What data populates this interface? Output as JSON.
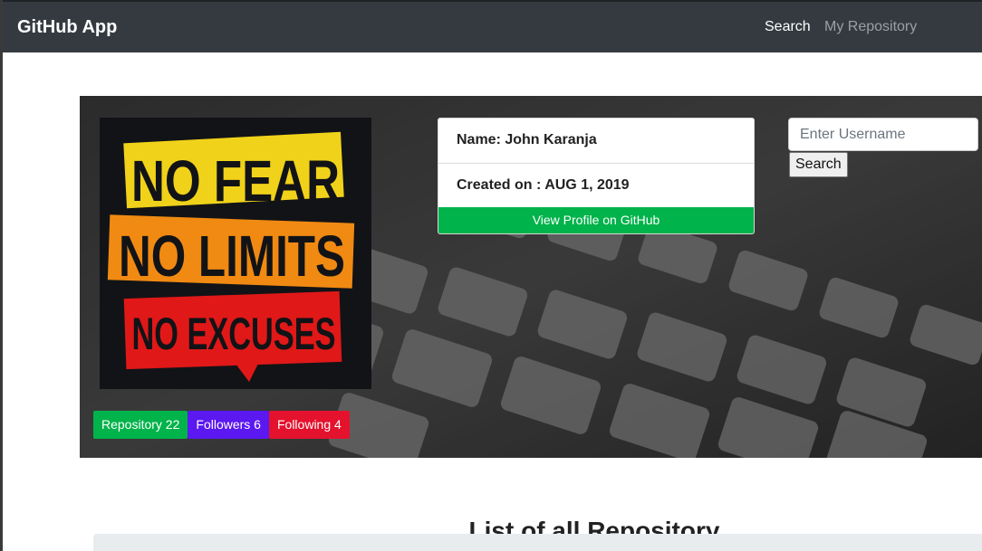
{
  "navbar": {
    "brand": "GitHub App",
    "links": [
      "Search",
      "My Repository"
    ]
  },
  "profile": {
    "avatar_alt": "profile avatar",
    "avatar_lines": [
      "NO FEAR",
      "NO LIMITS",
      "NO EXCUSES"
    ],
    "name": "Name: John Karanja",
    "created": "Created on : AUG 1, 2019",
    "view_button": "View Profile on GitHub"
  },
  "badges": {
    "repositories": "Repository 22",
    "followers": "Followers 6",
    "following": "Following 4"
  },
  "search": {
    "placeholder": "Enter Username",
    "button": "Search"
  },
  "repo_list": {
    "title": "List of all Repository"
  },
  "colors": {
    "navbar": "#343a40",
    "success": "#00b34a",
    "followers": "#5b18f0",
    "following": "#e4122d"
  }
}
